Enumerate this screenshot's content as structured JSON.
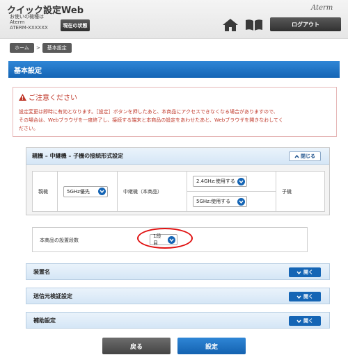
{
  "header": {
    "title": "クイック設定Web",
    "device_caption": "お使いの機種は",
    "device_name": "Aterm",
    "device_id": "ATERM-XXXXXX",
    "status_label": "現在の状態",
    "brand_logo": "Aterm",
    "logout_label": "ログアウト",
    "icons": [
      "home-icon",
      "manual-icon"
    ]
  },
  "breadcrumb": {
    "home": "ホーム",
    "separator": ">",
    "current": "基本設定"
  },
  "page_title": "基本設定",
  "caution": {
    "title": "ご注意ください",
    "line1": "設定変更は即時に有効となります。［設定］ボタンを押したあと、本商品にアクセスできなくなる場合がありますので、",
    "line2": "その場合は、Webブラウザを一度終了し、接続する端末と本商品の設定をあわせたあと、Webブラウザを開きなおしてく",
    "line3": "ださい。"
  },
  "connection": {
    "header": "親機 – 中継機 – 子機の接続形式設定",
    "close_label": "閉じる",
    "parent_label": "親機",
    "parent_value": "5GHz優先",
    "repeater_label": "中継機（本商品）",
    "repeater_value_top": "2.4GHz:使用する",
    "repeater_value_bottom": "5GHz:使用する",
    "child_label": "子機"
  },
  "install_count": {
    "label": "本商品の設置段数",
    "value": "1段目"
  },
  "sections": [
    {
      "label": "装置名",
      "button": "開く"
    },
    {
      "label": "送信元検証設定",
      "button": "開く"
    },
    {
      "label": "補助設定",
      "button": "開く"
    }
  ],
  "footer": {
    "back_label": "戻る",
    "apply_label": "設定"
  },
  "colors": {
    "accent": "#1565b5",
    "caution": "#c0392b",
    "highlight": "#e01010"
  }
}
